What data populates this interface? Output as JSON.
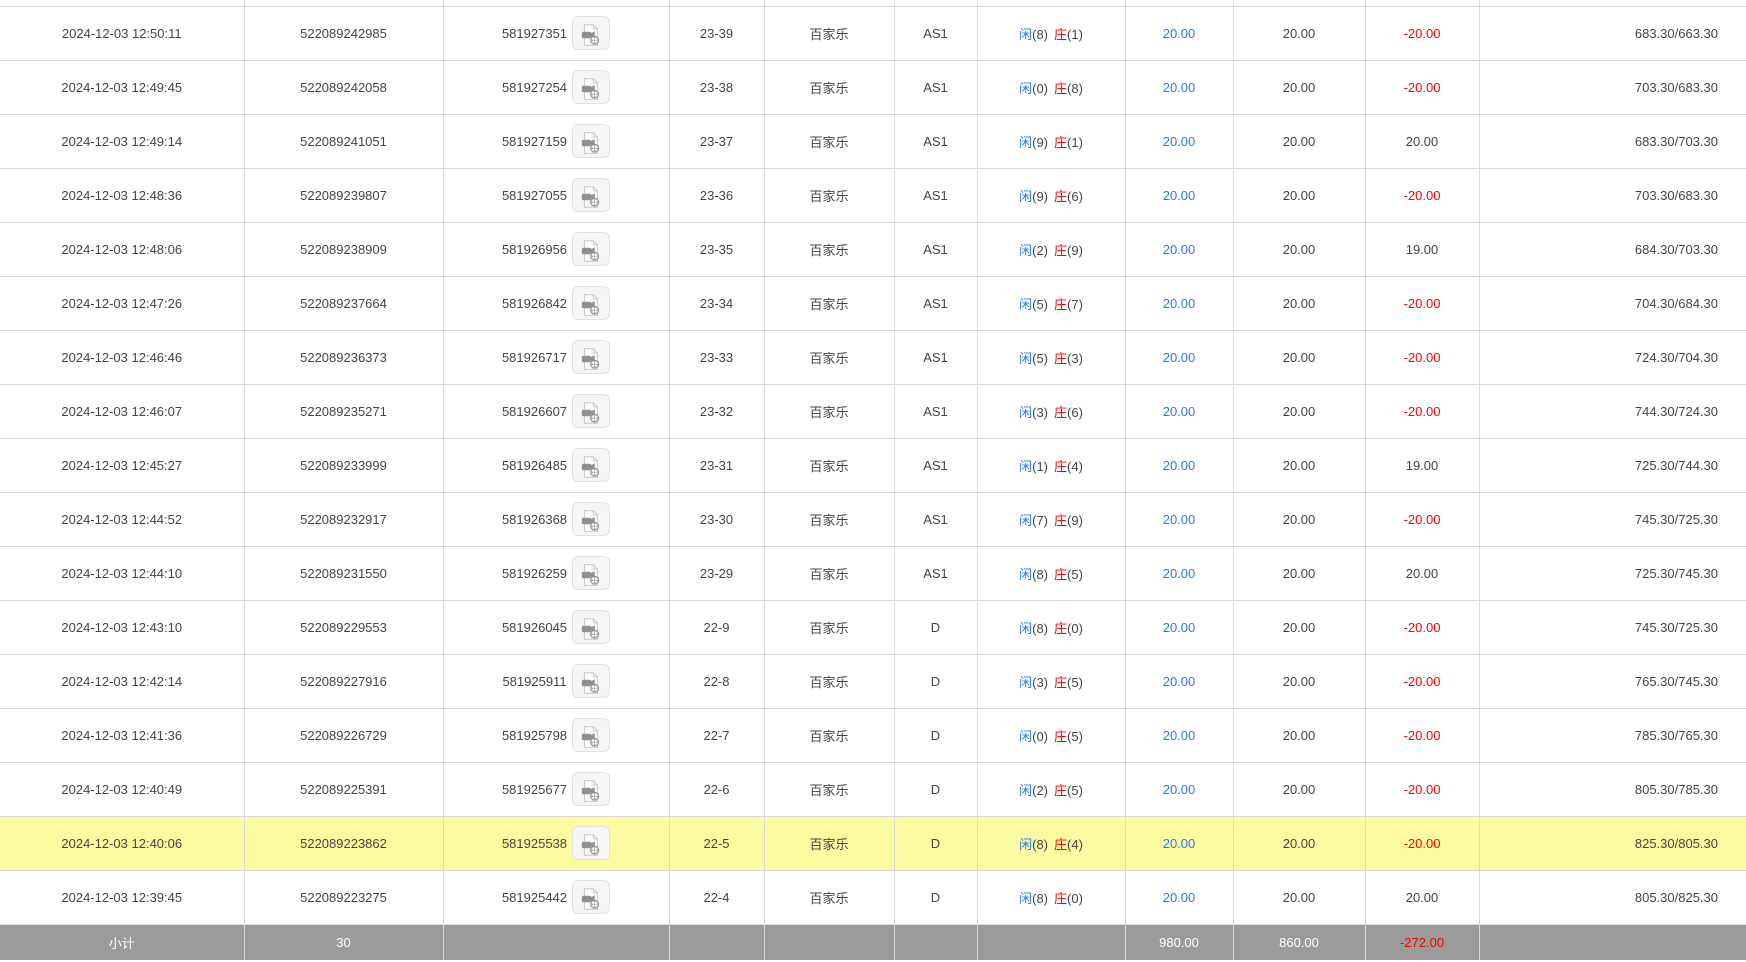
{
  "table": {
    "rows": [
      {
        "time": "2024-12-03 12:50:11",
        "order_no": "522089242985",
        "game_no": "581927351",
        "round": "23-39",
        "game_type": "百家乐",
        "table_name": "AS1",
        "result_player_label": "闲",
        "result_player": "(8)",
        "result_banker_label": "庄",
        "result_banker": "(1)",
        "bet": "20.00",
        "valid": "20.00",
        "win_loss": "-20.00",
        "balance": "683.30/663.30",
        "highlighted": false
      },
      {
        "time": "2024-12-03 12:49:45",
        "order_no": "522089242058",
        "game_no": "581927254",
        "round": "23-38",
        "game_type": "百家乐",
        "table_name": "AS1",
        "result_player_label": "闲",
        "result_player": "(0)",
        "result_banker_label": "庄",
        "result_banker": "(8)",
        "bet": "20.00",
        "valid": "20.00",
        "win_loss": "-20.00",
        "balance": "703.30/683.30",
        "highlighted": false
      },
      {
        "time": "2024-12-03 12:49:14",
        "order_no": "522089241051",
        "game_no": "581927159",
        "round": "23-37",
        "game_type": "百家乐",
        "table_name": "AS1",
        "result_player_label": "闲",
        "result_player": "(9)",
        "result_banker_label": "庄",
        "result_banker": "(1)",
        "bet": "20.00",
        "valid": "20.00",
        "win_loss": "20.00",
        "balance": "683.30/703.30",
        "highlighted": false
      },
      {
        "time": "2024-12-03 12:48:36",
        "order_no": "522089239807",
        "game_no": "581927055",
        "round": "23-36",
        "game_type": "百家乐",
        "table_name": "AS1",
        "result_player_label": "闲",
        "result_player": "(9)",
        "result_banker_label": "庄",
        "result_banker": "(6)",
        "bet": "20.00",
        "valid": "20.00",
        "win_loss": "-20.00",
        "balance": "703.30/683.30",
        "highlighted": false
      },
      {
        "time": "2024-12-03 12:48:06",
        "order_no": "522089238909",
        "game_no": "581926956",
        "round": "23-35",
        "game_type": "百家乐",
        "table_name": "AS1",
        "result_player_label": "闲",
        "result_player": "(2)",
        "result_banker_label": "庄",
        "result_banker": "(9)",
        "bet": "20.00",
        "valid": "20.00",
        "win_loss": "19.00",
        "balance": "684.30/703.30",
        "highlighted": false
      },
      {
        "time": "2024-12-03 12:47:26",
        "order_no": "522089237664",
        "game_no": "581926842",
        "round": "23-34",
        "game_type": "百家乐",
        "table_name": "AS1",
        "result_player_label": "闲",
        "result_player": "(5)",
        "result_banker_label": "庄",
        "result_banker": "(7)",
        "bet": "20.00",
        "valid": "20.00",
        "win_loss": "-20.00",
        "balance": "704.30/684.30",
        "highlighted": false
      },
      {
        "time": "2024-12-03 12:46:46",
        "order_no": "522089236373",
        "game_no": "581926717",
        "round": "23-33",
        "game_type": "百家乐",
        "table_name": "AS1",
        "result_player_label": "闲",
        "result_player": "(5)",
        "result_banker_label": "庄",
        "result_banker": "(3)",
        "bet": "20.00",
        "valid": "20.00",
        "win_loss": "-20.00",
        "balance": "724.30/704.30",
        "highlighted": false
      },
      {
        "time": "2024-12-03 12:46:07",
        "order_no": "522089235271",
        "game_no": "581926607",
        "round": "23-32",
        "game_type": "百家乐",
        "table_name": "AS1",
        "result_player_label": "闲",
        "result_player": "(3)",
        "result_banker_label": "庄",
        "result_banker": "(6)",
        "bet": "20.00",
        "valid": "20.00",
        "win_loss": "-20.00",
        "balance": "744.30/724.30",
        "highlighted": false
      },
      {
        "time": "2024-12-03 12:45:27",
        "order_no": "522089233999",
        "game_no": "581926485",
        "round": "23-31",
        "game_type": "百家乐",
        "table_name": "AS1",
        "result_player_label": "闲",
        "result_player": "(1)",
        "result_banker_label": "庄",
        "result_banker": "(4)",
        "bet": "20.00",
        "valid": "20.00",
        "win_loss": "19.00",
        "balance": "725.30/744.30",
        "highlighted": false
      },
      {
        "time": "2024-12-03 12:44:52",
        "order_no": "522089232917",
        "game_no": "581926368",
        "round": "23-30",
        "game_type": "百家乐",
        "table_name": "AS1",
        "result_player_label": "闲",
        "result_player": "(7)",
        "result_banker_label": "庄",
        "result_banker": "(9)",
        "bet": "20.00",
        "valid": "20.00",
        "win_loss": "-20.00",
        "balance": "745.30/725.30",
        "highlighted": false
      },
      {
        "time": "2024-12-03 12:44:10",
        "order_no": "522089231550",
        "game_no": "581926259",
        "round": "23-29",
        "game_type": "百家乐",
        "table_name": "AS1",
        "result_player_label": "闲",
        "result_player": "(8)",
        "result_banker_label": "庄",
        "result_banker": "(5)",
        "bet": "20.00",
        "valid": "20.00",
        "win_loss": "20.00",
        "balance": "725.30/745.30",
        "highlighted": false
      },
      {
        "time": "2024-12-03 12:43:10",
        "order_no": "522089229553",
        "game_no": "581926045",
        "round": "22-9",
        "game_type": "百家乐",
        "table_name": "D",
        "result_player_label": "闲",
        "result_player": "(8)",
        "result_banker_label": "庄",
        "result_banker": "(0)",
        "bet": "20.00",
        "valid": "20.00",
        "win_loss": "-20.00",
        "balance": "745.30/725.30",
        "highlighted": false
      },
      {
        "time": "2024-12-03 12:42:14",
        "order_no": "522089227916",
        "game_no": "581925911",
        "round": "22-8",
        "game_type": "百家乐",
        "table_name": "D",
        "result_player_label": "闲",
        "result_player": "(3)",
        "result_banker_label": "庄",
        "result_banker": "(5)",
        "bet": "20.00",
        "valid": "20.00",
        "win_loss": "-20.00",
        "balance": "765.30/745.30",
        "highlighted": false
      },
      {
        "time": "2024-12-03 12:41:36",
        "order_no": "522089226729",
        "game_no": "581925798",
        "round": "22-7",
        "game_type": "百家乐",
        "table_name": "D",
        "result_player_label": "闲",
        "result_player": "(0)",
        "result_banker_label": "庄",
        "result_banker": "(5)",
        "bet": "20.00",
        "valid": "20.00",
        "win_loss": "-20.00",
        "balance": "785.30/765.30",
        "highlighted": false
      },
      {
        "time": "2024-12-03 12:40:49",
        "order_no": "522089225391",
        "game_no": "581925677",
        "round": "22-6",
        "game_type": "百家乐",
        "table_name": "D",
        "result_player_label": "闲",
        "result_player": "(2)",
        "result_banker_label": "庄",
        "result_banker": "(5)",
        "bet": "20.00",
        "valid": "20.00",
        "win_loss": "-20.00",
        "balance": "805.30/785.30",
        "highlighted": false
      },
      {
        "time": "2024-12-03 12:40:06",
        "order_no": "522089223862",
        "game_no": "581925538",
        "round": "22-5",
        "game_type": "百家乐",
        "table_name": "D",
        "result_player_label": "闲",
        "result_player": "(8)",
        "result_banker_label": "庄",
        "result_banker": "(4)",
        "bet": "20.00",
        "valid": "20.00",
        "win_loss": "-20.00",
        "balance": "825.30/805.30",
        "highlighted": true
      },
      {
        "time": "2024-12-03 12:39:45",
        "order_no": "522089223275",
        "game_no": "581925442",
        "round": "22-4",
        "game_type": "百家乐",
        "table_name": "D",
        "result_player_label": "闲",
        "result_player": "(8)",
        "result_banker_label": "庄",
        "result_banker": "(0)",
        "bet": "20.00",
        "valid": "20.00",
        "win_loss": "20.00",
        "balance": "805.30/825.30",
        "highlighted": false
      }
    ],
    "footer": {
      "label": "小计",
      "count": "30",
      "bet_total": "980.00",
      "valid_total": "860.00",
      "win_loss_total": "-272.00"
    }
  },
  "icons": {
    "video_replay": "video-file-icon"
  },
  "colors": {
    "accent_blue": "#2b7af3",
    "negative_red": "#ff0000",
    "highlight_yellow": "#fbfba1",
    "footer_gray": "#9b9b9b",
    "border_gray": "#d9d9d9"
  }
}
